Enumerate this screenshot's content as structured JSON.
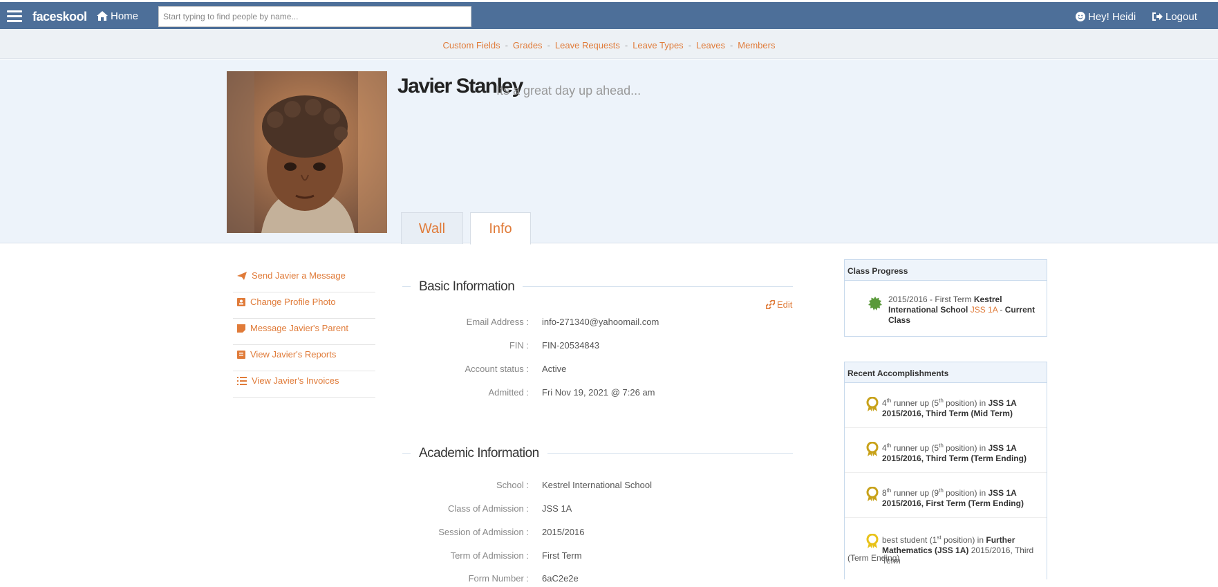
{
  "topbar": {
    "brand": "faceskool",
    "home_label": "Home",
    "search_placeholder": "Start typing to find people by name...",
    "greeting": "Hey! Heidi",
    "logout_label": "Logout"
  },
  "subnav": {
    "items": [
      "Custom Fields",
      "Grades",
      "Leave Requests",
      "Leave Types",
      "Leaves",
      "Members"
    ]
  },
  "profile": {
    "name": "Javier Stanley",
    "tagline": "Its a great day up ahead...",
    "tabs": [
      "Wall",
      "Info"
    ],
    "active_tab": "Info"
  },
  "left_menu": [
    {
      "label": "Send Javier a Message",
      "icon": "paper-plane-icon"
    },
    {
      "label": "Change Profile Photo",
      "icon": "portrait-icon"
    },
    {
      "label": "Message Javier's Parent",
      "icon": "sticky-note-icon"
    },
    {
      "label": "View Javier's Reports",
      "icon": "report-icon"
    },
    {
      "label": "View Javier's Invoices",
      "icon": "list-icon"
    }
  ],
  "basic_info": {
    "title": "Basic Information",
    "edit_label": "Edit",
    "fields": [
      {
        "label": "Email Address :",
        "value": "info-271340@yahoomail.com"
      },
      {
        "label": "FIN :",
        "value": "FIN-20534843"
      },
      {
        "label": "Account status :",
        "value": "Active"
      },
      {
        "label": "Admitted :",
        "value": "Fri Nov 19, 2021 @ 7:26 am"
      }
    ]
  },
  "academic_info": {
    "title": "Academic Information",
    "fields": [
      {
        "label": "School :",
        "value": "Kestrel International School"
      },
      {
        "label": "Class of Admission :",
        "value": "JSS 1A"
      },
      {
        "label": "Session of Admission :",
        "value": "2015/2016"
      },
      {
        "label": "Term of Admission :",
        "value": "First Term"
      },
      {
        "label": "Form Number :",
        "value": "6aC2e2e"
      }
    ]
  },
  "class_progress": {
    "title": "Class Progress",
    "entry": {
      "session": "2015/2016 - First Term",
      "school": "Kestrel International School",
      "class": "JSS 1A",
      "sep": "-",
      "status": "Current Class"
    }
  },
  "accomplishments": {
    "title": "Recent Accomplishments",
    "items": [
      {
        "rank_num": "4",
        "rank_sup": "th",
        "rank_text": "runner up (",
        "pos_num": "5",
        "pos_sup": "th",
        "pos_text": "position) in",
        "class": "JSS 1A",
        "detail": "2015/2016, Third Term (Mid Term)"
      },
      {
        "rank_num": "4",
        "rank_sup": "th",
        "rank_text": "runner up (",
        "pos_num": "5",
        "pos_sup": "th",
        "pos_text": "position) in",
        "class": "JSS 1A",
        "detail": "2015/2016, Third Term (Term Ending)"
      },
      {
        "rank_num": "8",
        "rank_sup": "th",
        "rank_text": "runner up (",
        "pos_num": "9",
        "pos_sup": "th",
        "pos_text": "position) in",
        "class": "JSS 1A",
        "detail": "2015/2016, First Term (Term Ending)"
      },
      {
        "rank_text": "best student (",
        "pos_num": "1",
        "pos_sup": "st",
        "pos_text": "position) in",
        "subject": "Further Mathematics (JSS 1A)",
        "detail": "2015/2016, Third Term",
        "detail2": "(Term Ending)"
      }
    ]
  },
  "colors": {
    "topbar": "#4d6f99",
    "accent": "#e07b39",
    "banner": "#edf3fa",
    "progress_icon": "#5a9a3a",
    "award_icon": "#c8a21a"
  }
}
